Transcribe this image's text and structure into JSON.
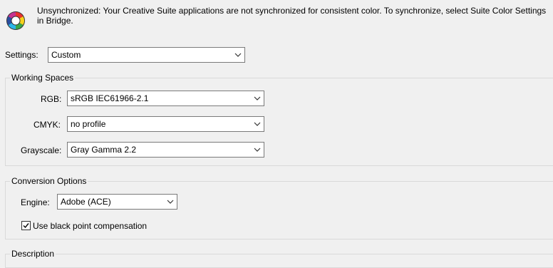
{
  "sync": {
    "message": "Unsynchronized: Your Creative Suite applications are not synchronized for consistent color. To synchronize, select Suite Color Settings in Bridge.",
    "icon": "color-sync-wheel-icon"
  },
  "settings": {
    "label": "Settings:",
    "value": "Custom"
  },
  "working_spaces": {
    "title": "Working Spaces",
    "rgb": {
      "label": "RGB:",
      "value": "sRGB IEC61966-2.1"
    },
    "cmyk": {
      "label": "CMYK:",
      "value": "no profile"
    },
    "grayscale": {
      "label": "Grayscale:",
      "value": "Gray Gamma 2.2"
    }
  },
  "conversion_options": {
    "title": "Conversion Options",
    "engine": {
      "label": "Engine:",
      "value": "Adobe (ACE)"
    },
    "black_point": {
      "label": "Use black point compensation",
      "checked": true
    }
  },
  "description": {
    "title": "Description"
  }
}
